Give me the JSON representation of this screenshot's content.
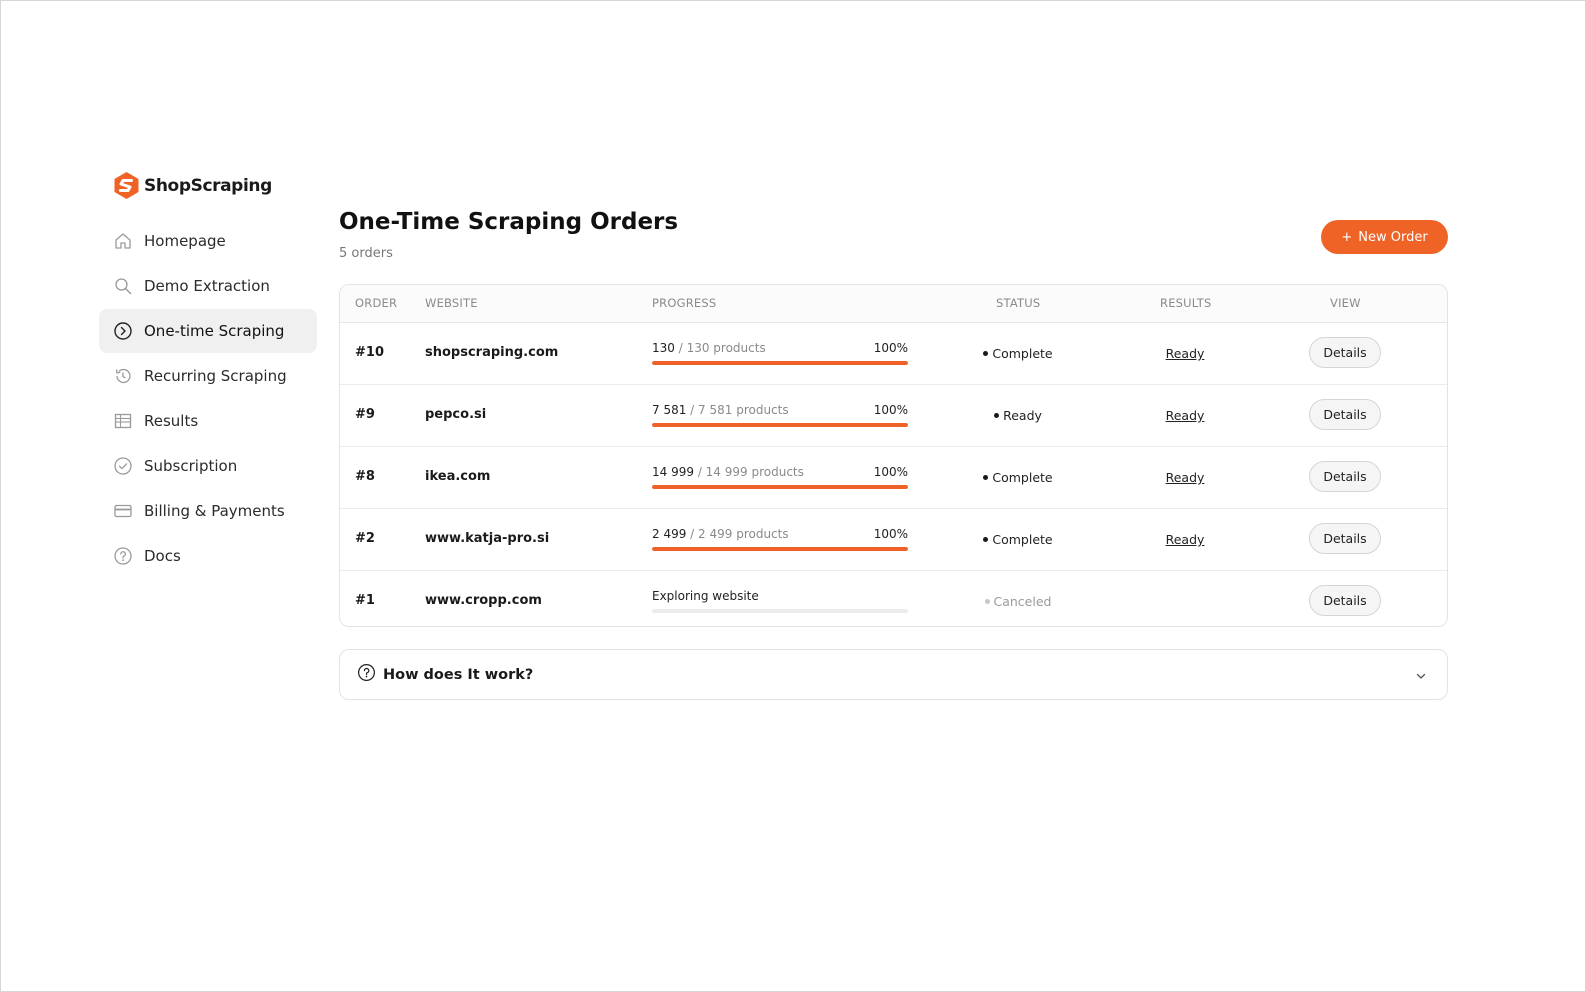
{
  "brand": {
    "name": "ShopScraping",
    "accent": "#f06326"
  },
  "sidebar": {
    "items": [
      {
        "label": "Homepage",
        "icon": "home-icon",
        "active": false
      },
      {
        "label": "Demo Extraction",
        "icon": "search-icon",
        "active": false
      },
      {
        "label": "One-time Scraping",
        "icon": "play-circle-icon",
        "active": true
      },
      {
        "label": "Recurring Scraping",
        "icon": "history-icon",
        "active": false
      },
      {
        "label": "Results",
        "icon": "table-icon",
        "active": false
      },
      {
        "label": "Subscription",
        "icon": "check-circle-icon",
        "active": false
      },
      {
        "label": "Billing & Payments",
        "icon": "credit-card-icon",
        "active": false
      },
      {
        "label": "Docs",
        "icon": "help-circle-icon",
        "active": false
      }
    ]
  },
  "main": {
    "title": "One-Time Scraping Orders",
    "subtitle": "5 orders",
    "new_order_label": "New Order",
    "columns": {
      "order": "ORDER",
      "website": "WEBSITE",
      "progress": "PROGRESS",
      "status": "STATUS",
      "results": "RESULTS",
      "view": "VIEW"
    },
    "rows": [
      {
        "order": "#10",
        "website": "shopscraping.com",
        "progress_count": "130",
        "progress_total": " / 130 products",
        "progress_pct": "100%",
        "progress_fraction": 1.0,
        "status": "Complete",
        "result": "Ready",
        "view": "Details"
      },
      {
        "order": "#9",
        "website": "pepco.si",
        "progress_count": "7 581",
        "progress_total": " / 7 581 products",
        "progress_pct": "100%",
        "progress_fraction": 1.0,
        "status": "Ready",
        "result": "Ready",
        "view": "Details"
      },
      {
        "order": "#8",
        "website": "ikea.com",
        "progress_count": "14 999",
        "progress_total": " / 14 999 products",
        "progress_pct": "100%",
        "progress_fraction": 1.0,
        "status": "Complete",
        "result": "Ready",
        "view": "Details"
      },
      {
        "order": "#2",
        "website": "www.katja-pro.si",
        "progress_count": "2 499",
        "progress_total": " / 2 499 products",
        "progress_pct": "100%",
        "progress_fraction": 1.0,
        "status": "Complete",
        "result": "Ready",
        "view": "Details"
      },
      {
        "order": "#1",
        "website": "www.cropp.com",
        "progress_count": "Exploring website",
        "progress_total": "",
        "progress_pct": "",
        "progress_fraction": 0,
        "status": "Canceled",
        "result": "",
        "view": "Details"
      }
    ],
    "faq_label": "How does It work?"
  }
}
